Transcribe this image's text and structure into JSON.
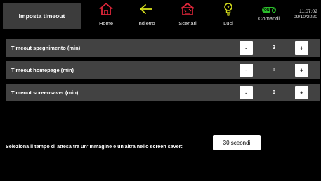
{
  "header": {
    "page_title": "Imposta timeout",
    "nav": {
      "home": "Home",
      "back": "Indietro",
      "scenes": "Scenari",
      "lights": "Luci",
      "commands": "Comandi"
    },
    "on_badge": "ON",
    "clock": {
      "time": "11:07:02",
      "date": "09/10/2020"
    }
  },
  "settings": [
    {
      "label": "Timeout spegnimento (min)",
      "minus": "-",
      "value": "3",
      "plus": "+"
    },
    {
      "label": "Timeout homepage (min)",
      "minus": "-",
      "value": "0",
      "plus": "+"
    },
    {
      "label": "Timeout screensaver (min)",
      "minus": "-",
      "value": "0",
      "plus": "+"
    }
  ],
  "screensaver": {
    "label": "Seleziona il tempo di attesa tra un'immagine e un'altra nello screen saver:",
    "selected": "30 sceondi"
  },
  "icons": {
    "home": "home-icon",
    "back": "back-arrow-icon",
    "scenes": "scenes-icon",
    "lights": "lightbulb-icon",
    "commands": "on-switch-icon"
  },
  "colors": {
    "home_icon": "#e0263a",
    "back_icon": "#d8e01c",
    "scenes_icon": "#e0263a",
    "lights_icon": "#d8e01c",
    "commands_icon": "#2bc02b",
    "row_background": "#424242",
    "title_background": "#3c3c3c"
  }
}
